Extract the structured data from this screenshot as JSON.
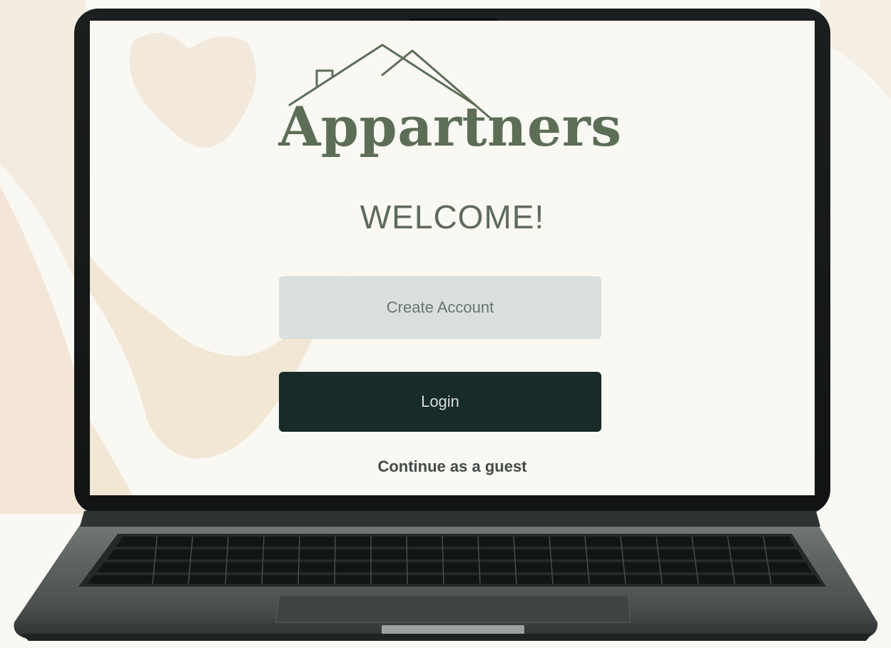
{
  "app": {
    "brand_name": "Appartners",
    "logo_icon": "house-roof-icon"
  },
  "screen": {
    "welcome": "WELCOME!",
    "create_account_label": "Create Account",
    "login_label": "Login",
    "guest_label": "Continue as a guest"
  },
  "colors": {
    "brand_green": "#5d6e57",
    "create_button_bg": "#d9dfdf",
    "login_button_bg": "#172b2a",
    "screen_bg": "#f9f8f3",
    "page_bg": "#faf8f3"
  }
}
